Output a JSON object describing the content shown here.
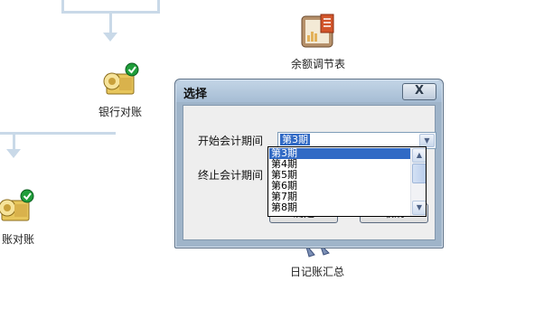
{
  "flowchart": {
    "nodes": {
      "balance_adjust": {
        "label": "余额调节表",
        "icon": "balance-adjustment-icon"
      },
      "bank_reconcile": {
        "label": "银行对账",
        "icon": "bank-reconciliation-icon"
      },
      "ledger_reconcile": {
        "label": "总账对账",
        "visible_label": "账对账",
        "icon": "ledger-reconciliation-icon"
      },
      "journal_summary": {
        "label": "日记账汇总",
        "icon": "journal-summary-icon"
      }
    }
  },
  "dialog": {
    "title": "选择",
    "close_label": "X",
    "start_period_label": "开始会计期间",
    "end_period_label": "终止会计期间",
    "start_period_value": "第3期",
    "ok_label": "确定",
    "cancel_label": "取消",
    "dropdown_options": [
      "第3期",
      "第4期",
      "第5期",
      "第6期",
      "第7期",
      "第8期"
    ],
    "dropdown_selected": "第3期"
  },
  "colors": {
    "selection": "#316ac5",
    "connector": "#c9d9e8",
    "dialog_frame": "#9fb4c9"
  }
}
